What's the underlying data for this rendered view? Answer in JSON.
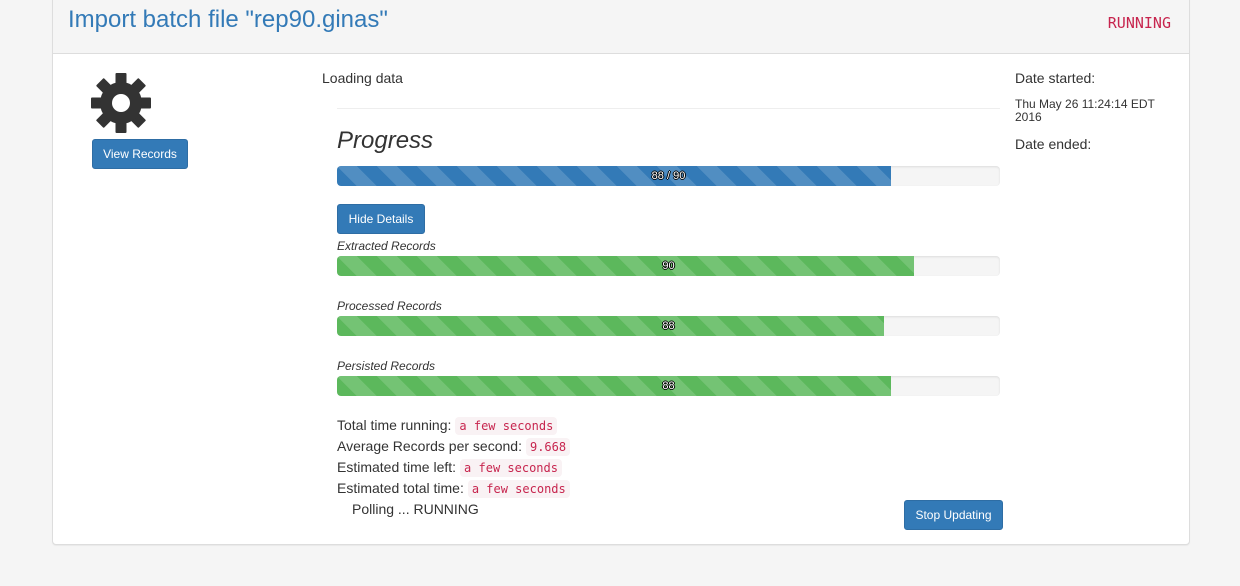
{
  "header": {
    "title": "Import batch file \"rep90.ginas\"",
    "status": "RUNNING",
    "title_color": "#337ab7",
    "status_color": "#c7254e"
  },
  "left": {
    "icon": "gear-icon",
    "view_records_label": "View Records"
  },
  "main": {
    "loading_label": "Loading data",
    "progress_heading": "Progress",
    "overall_progress": {
      "text": "88 / 90",
      "fraction": 0.836
    },
    "hide_details_label": "Hide Details",
    "details": [
      {
        "label": "Extracted Records",
        "text": "90",
        "fraction": 0.87
      },
      {
        "label": "Processed Records",
        "text": "88",
        "fraction": 0.825
      },
      {
        "label": "Persisted Records",
        "text": "88",
        "fraction": 0.836
      }
    ],
    "stats": [
      {
        "label": "Total time running:",
        "value": "a few seconds"
      },
      {
        "label": "Average Records per second:",
        "value": "9.668"
      },
      {
        "label": "Estimated time left:",
        "value": "a few seconds"
      },
      {
        "label": "Estimated total time:",
        "value": "a few seconds"
      }
    ],
    "polling_text": "Polling ... RUNNING",
    "stop_updating_label": "Stop Updating"
  },
  "dates": {
    "started_label": "Date started:",
    "started_value": "Thu May 26 11:24:14 EDT 2016",
    "ended_label": "Date ended:",
    "ended_value": ""
  },
  "colors": {
    "primary": "#337ab7",
    "success": "#5cb85c",
    "code": "#c7254e"
  }
}
